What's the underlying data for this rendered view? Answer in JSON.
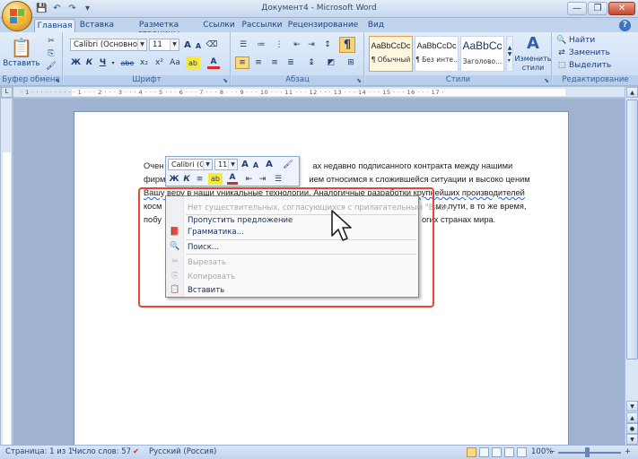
{
  "window": {
    "title": "Документ4 - Microsoft Word",
    "minimize": "—",
    "maximize": "❐",
    "close": "✕"
  },
  "tabs": [
    "Главная",
    "Вставка",
    "Разметка страницы",
    "Ссылки",
    "Рассылки",
    "Рецензирование",
    "Вид"
  ],
  "ribbon": {
    "clipboard": {
      "paste": "Вставить",
      "label": "Буфер обмена"
    },
    "font": {
      "name": "Calibri (Основной те",
      "size": "11",
      "grow": "A",
      "shrink": "A",
      "bold": "Ж",
      "italic": "К",
      "underline": "Ч",
      "strike": "abe",
      "sub": "x₂",
      "sup": "x²",
      "case": "Aa",
      "highlight": "ab",
      "color": "A",
      "label": "Шрифт"
    },
    "paragraph": {
      "label": "Абзац",
      "marks": "¶"
    },
    "styles": {
      "label": "Стили",
      "items": [
        {
          "sample": "AaBbCcDc",
          "name": "¶ Обычный"
        },
        {
          "sample": "AaBbCcDc",
          "name": "¶ Без инте..."
        },
        {
          "sample": "AaBbCc",
          "name": "Заголово..."
        }
      ],
      "change": "Изменить стили"
    },
    "editing": {
      "find": "Найти",
      "replace": "Заменить",
      "select": "Выделить",
      "label": "Редактирование"
    }
  },
  "ruler_ticks": "· 1 · · · · · · · · · · 1 · · · 2 · · · 3 · · · 4 · · · 5 · · · 6 · · · 7 · · · 8 · · · 9 · · · 10 · · · 11 · · · 12 · · · 13 · · · 14 · · · 15 · · · 16 · · · 17 ·",
  "document": {
    "lines": [
      "Очен",
      "фирм",
      "Вашу веру в наши уникальные технологии. Аналогичные разработки крупнейших производителей",
      "косм",
      "побу"
    ],
    "line1_tail": "ах недавно подписанного контракта между нашими",
    "line2_tail": "ием относимся к сложившейся ситуации и высоко ценим",
    "line4_tail": "ми пути, в то же время,",
    "line5_tail": "огих странах мира."
  },
  "mini_toolbar": {
    "font": "Calibri (Ос",
    "size": "11"
  },
  "context_menu": {
    "suggestion": "Нет существительных, согласующихся с прилагательным \"Вашу\".",
    "skip": "Пропустить предложение",
    "grammar": "Грамматика...",
    "search": "Поиск...",
    "cut": "Вырезать",
    "copy": "Копировать",
    "paste": "Вставить"
  },
  "status": {
    "page": "Страница: 1 из 1",
    "words": "Число слов: 57",
    "language": "Русский (Россия)",
    "zoom": "100%"
  }
}
